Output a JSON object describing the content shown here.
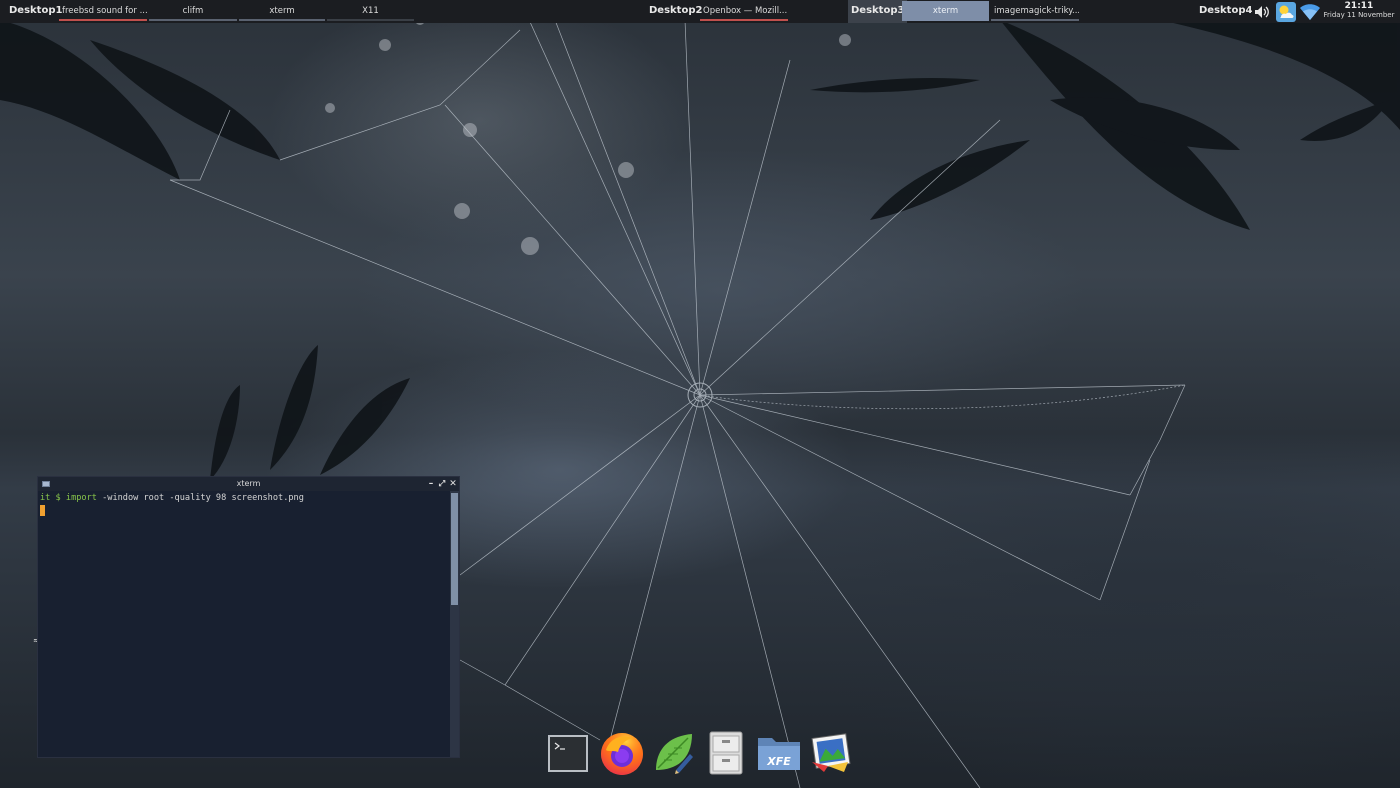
{
  "top_panel": {
    "desktops": [
      {
        "label": "Desktop1",
        "tasks": [
          "freebsd sound for ...",
          "clifm",
          "xterm",
          "X11"
        ]
      },
      {
        "label": "Desktop2",
        "tasks": [
          "Openbox — Mozill..."
        ]
      },
      {
        "label": "Desktop3",
        "tasks": [
          "xterm",
          "imagemagick-triky..."
        ]
      },
      {
        "label": "Desktop4",
        "tasks": []
      }
    ],
    "tray": {
      "volume_icon": "speaker-icon",
      "weather_icon": "weather-sun-cloud-icon",
      "wifi_icon": "wifi-icon"
    },
    "clock": {
      "time": "21:11",
      "date": "Friday 11 November"
    }
  },
  "xterm": {
    "title": "xterm",
    "buttons": {
      "minimize": "–",
      "maximize": "⤢",
      "close": "✕"
    },
    "prompt_user": "it $",
    "command_name": "import",
    "command_args": " -window root -quality 98 screenshot.png"
  },
  "dock": {
    "items": [
      {
        "name": "terminal",
        "icon": "terminal-icon"
      },
      {
        "name": "firefox",
        "icon": "firefox-icon"
      },
      {
        "name": "text-editor",
        "icon": "leaf-pen-editor-icon"
      },
      {
        "name": "file-cabinet",
        "icon": "file-cabinet-icon"
      },
      {
        "name": "xfe",
        "icon": "xfe-folder-icon",
        "label": "XFE"
      },
      {
        "name": "image-viewer",
        "icon": "photo-window-icon"
      }
    ]
  },
  "colors": {
    "panel_bg": "#1b1d21",
    "active_task": "#7e8ea8",
    "underline_red": "#c0504d",
    "terminal_bg": "#182030",
    "prompt_green": "#86c34a",
    "cursor_orange": "#f0a030"
  }
}
